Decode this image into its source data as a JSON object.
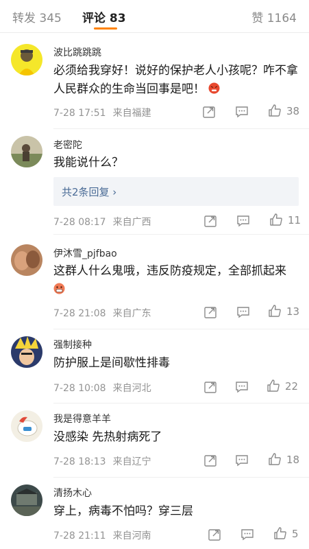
{
  "tabs": {
    "repost_label": "转发",
    "repost_count": "345",
    "comments_label": "评论",
    "comments_count": "83",
    "likes_label": "赞",
    "likes_count": "1164"
  },
  "comments": [
    {
      "username": "波比跳跳跳",
      "text": "必须给我穿好！说好的保护老人小孩呢？咋不拿人民群众的生命当回事是吧！",
      "time": "7-28 17:51",
      "location": "来自福建",
      "likes": "38",
      "emoji_icon": "angry-face-icon"
    },
    {
      "username": "老密陀",
      "text": "我能说什么？",
      "time": "7-28 08:17",
      "location": "来自广西",
      "likes": "11",
      "replies": "共2条回复 ›"
    },
    {
      "username": "伊沐雪_pjfbao",
      "text": "这群人什么鬼哦，违反防疫规定，全部抓起来",
      "time": "7-28 21:08",
      "location": "来自广东",
      "likes": "13",
      "emoji_icon": "grimace-face-icon"
    },
    {
      "username": "强制接种",
      "text": "防护服上是间歇性排毒",
      "time": "7-28 10:08",
      "location": "来自河北",
      "likes": "22"
    },
    {
      "username": "我是得意羊羊",
      "text": "没感染 先热射病死了",
      "time": "7-28 18:13",
      "location": "来自辽宁",
      "likes": "18"
    },
    {
      "username": "清扬木心",
      "text": "穿上，病毒不怕吗？穿三层",
      "time": "7-28 21:11",
      "location": "来自河南",
      "likes": "5"
    }
  ],
  "icons": {
    "share": "share-icon",
    "comment": "comment-icon",
    "like": "thumbs-up-icon"
  },
  "colors": {
    "accent": "#ff8200",
    "reply_link": "#4a6b96",
    "reply_bg": "#f2f4f7"
  }
}
